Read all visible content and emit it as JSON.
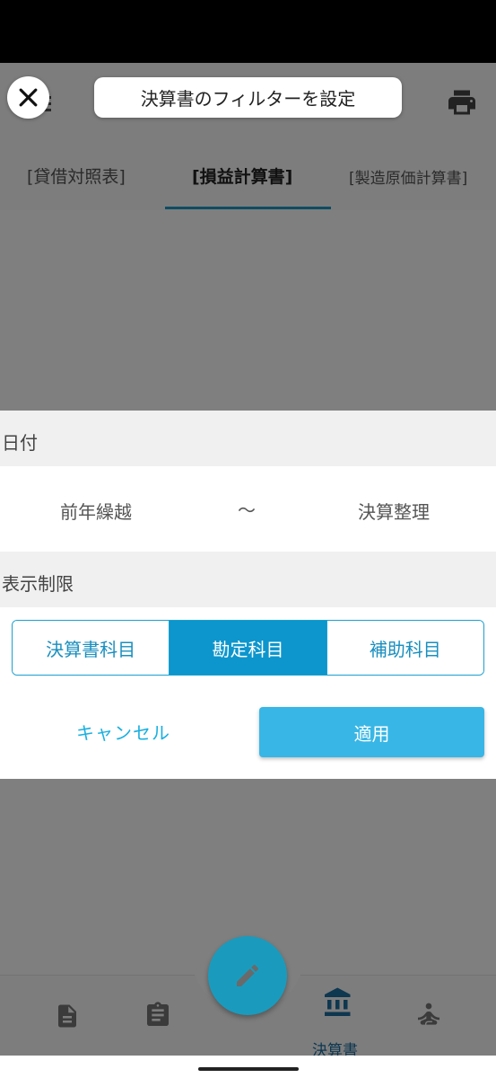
{
  "dialog": {
    "title": "決算書のフィルターを設定",
    "close_icon": "close-icon"
  },
  "header": {
    "left_icon": "menu-icon",
    "right_icon": "print-icon"
  },
  "tabs": [
    {
      "label": "[貸借対照表]",
      "active": false
    },
    {
      "label": "[損益計算書]",
      "active": true
    },
    {
      "label": "[製造原価計算書]",
      "active": false
    }
  ],
  "filter": {
    "date_section_label": "日付",
    "date_from": "前年繰越",
    "date_separator": "〜",
    "date_to": "決算整理",
    "limit_section_label": "表示制限",
    "segments": [
      {
        "label": "決算書科目",
        "active": false
      },
      {
        "label": "勘定科目",
        "active": true
      },
      {
        "label": "補助科目",
        "active": false
      }
    ],
    "cancel_label": "キャンセル",
    "apply_label": "適用"
  },
  "bottom_nav": {
    "fab_icon": "pencil-icon",
    "items": [
      {
        "icon": "document-icon",
        "label": ""
      },
      {
        "icon": "clipboard-icon",
        "label": ""
      },
      {
        "icon": "bank-icon",
        "label": "決算書",
        "active": true
      },
      {
        "icon": "meditation-icon",
        "label": ""
      }
    ]
  },
  "colors": {
    "accent": "#0d96cd",
    "apply_button": "#38b6e6",
    "cancel_text": "#1ab0e0",
    "overlay": "rgba(0,0,0,0.5)"
  }
}
